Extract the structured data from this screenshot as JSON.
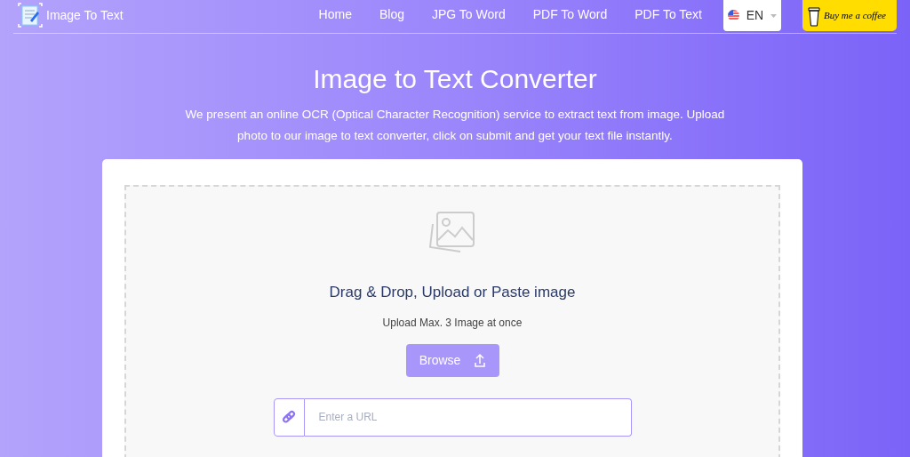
{
  "brand": "Image To Text",
  "nav": [
    {
      "label": "Home"
    },
    {
      "label": "Blog"
    },
    {
      "label": "JPG To Word"
    },
    {
      "label": "PDF To Word"
    },
    {
      "label": "PDF To Text"
    }
  ],
  "language": {
    "label": "EN"
  },
  "coffee_button": {
    "label": "Buy me a coffee"
  },
  "title": "Image to Text Converter",
  "description": "We present an online OCR (Optical Character Recognition) service to extract text from image. Upload photo to our image to text converter, click on submit and get your text file instantly.",
  "upload": {
    "heading": "Drag & Drop, Upload or Paste image",
    "hint": "Upload Max. 3 Image at once",
    "button": "Browse",
    "url_field": {
      "placeholder": "Enter a URL"
    }
  }
}
